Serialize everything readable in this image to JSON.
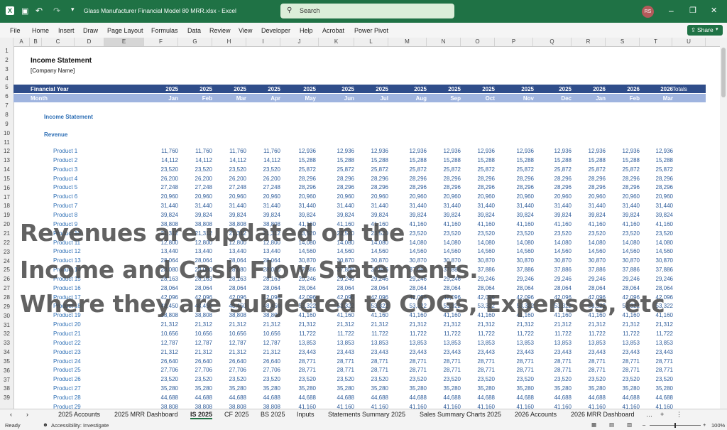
{
  "window": {
    "title": "Glass Manufacturer Financial Model 80 MRR.xlsx  -  Excel",
    "search_placeholder": "Search",
    "user_initials": "RS"
  },
  "menu": [
    "File",
    "Home",
    "Insert",
    "Draw",
    "Page Layout",
    "Formulas",
    "Data",
    "Review",
    "View",
    "Developer",
    "Help",
    "Acrobat",
    "Power Pivot"
  ],
  "share_label": "Share",
  "columns": [
    "A",
    "B",
    "C",
    "D",
    "E",
    "F",
    "G",
    "H",
    "I",
    "J",
    "K",
    "L",
    "M",
    "N",
    "O",
    "P",
    "Q",
    "R",
    "S",
    "T",
    "U"
  ],
  "sheet": {
    "title": "Income Statement",
    "company": "[Company Name]",
    "fy_label": "Financial Year",
    "month_label": "Month",
    "totals_label": "Totals",
    "years": [
      "2025",
      "2025",
      "2025",
      "2025",
      "2025",
      "2025",
      "2025",
      "2025",
      "2025",
      "2025",
      "2025",
      "2025",
      "2026",
      "2026",
      "2026"
    ],
    "months": [
      "Jan",
      "Feb",
      "Mar",
      "Apr",
      "May",
      "Jun",
      "Jul",
      "Aug",
      "Sep",
      "Oct",
      "Nov",
      "Dec",
      "Jan",
      "Feb",
      "Mar"
    ],
    "section": "Income Statement",
    "subsection": "Revenue",
    "products": [
      {
        "name": "Product 1",
        "a": "11,760",
        "b": "12,936"
      },
      {
        "name": "Product 2",
        "a": "14,112",
        "b": "15,288"
      },
      {
        "name": "Product 3",
        "a": "23,520",
        "b": "25,872"
      },
      {
        "name": "Product 4",
        "a": "26,200",
        "b": "28,296"
      },
      {
        "name": "Product 5",
        "a": "27,248",
        "b": "28,296"
      },
      {
        "name": "Product 6",
        "a": "20,960",
        "b": "20,960"
      },
      {
        "name": "Product 7",
        "a": "31,440",
        "b": "31,440"
      },
      {
        "name": "Product 8",
        "a": "39,824",
        "b": "39,824"
      },
      {
        "name": "Product 9",
        "a": "38,808",
        "b": "41,160"
      },
      {
        "name": "Product 10",
        "a": "21,312",
        "b": "23,520"
      },
      {
        "name": "Product 11",
        "a": "12,800",
        "b": "14,080"
      },
      {
        "name": "Product 12",
        "a": "13,440",
        "b": "14,560"
      },
      {
        "name": "Product 13",
        "a": "28,064",
        "b": "30,870"
      },
      {
        "name": "Product 14",
        "a": "28,080",
        "b": "37,886"
      },
      {
        "name": "Product 15",
        "a": "28,163",
        "b": "29,246"
      },
      {
        "name": "Product 16",
        "a": "28,064",
        "b": "28,064"
      },
      {
        "name": "Product 17",
        "a": "42,096",
        "b": "42,096"
      },
      {
        "name": "Product 18",
        "a": "48,450",
        "b": "53,322"
      },
      {
        "name": "Product 19",
        "a": "38,808",
        "b": "41,160"
      },
      {
        "name": "Product 20",
        "a": "21,312",
        "b": "21,312"
      },
      {
        "name": "Product 21",
        "a": "10,656",
        "b": "11,722"
      },
      {
        "name": "Product 22",
        "a": "12,787",
        "b": "13,853"
      },
      {
        "name": "Product 23",
        "a": "21,312",
        "b": "23,443"
      },
      {
        "name": "Product 24",
        "a": "26,640",
        "b": "28,771"
      },
      {
        "name": "Product 25",
        "a": "27,706",
        "b": "28,771"
      },
      {
        "name": "Product 26",
        "a": "23,520",
        "b": "23,520"
      },
      {
        "name": "Product 27",
        "a": "35,280",
        "b": "35,280"
      },
      {
        "name": "Product 28",
        "a": "44,688",
        "b": "44,688"
      },
      {
        "name": "Product 29",
        "a": "38,808",
        "b": "41,160"
      }
    ]
  },
  "overlay": [
    "Revenues are updated on the",
    "Income and Cash Flow Statements.",
    "Where they are subjected to COGs, Expenses, etc"
  ],
  "tabs": [
    "2025 Accounts",
    "2025 MRR Dashboard",
    "IS 2025",
    "CF 2025",
    "BS 2025",
    "Inputs",
    "Statements Summary 2025",
    "Sales Summary Charts 2025",
    "2026 Accounts",
    "2026 MRR Dashboard"
  ],
  "active_tab": "IS 2025",
  "status": {
    "ready": "Ready",
    "accessibility": "Accessibility: Investigate",
    "zoom": "100%"
  }
}
